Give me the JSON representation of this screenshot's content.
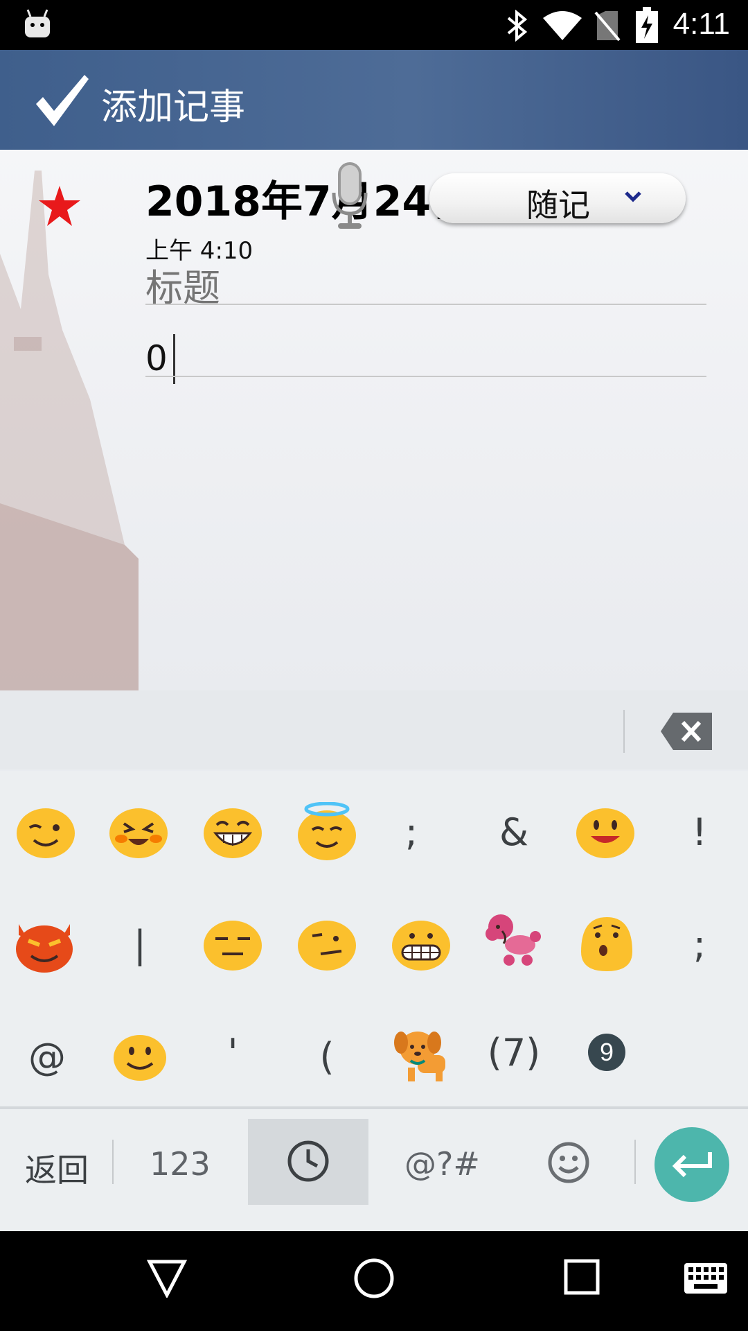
{
  "status_bar": {
    "time": "4:11",
    "icons": [
      "android-icon",
      "bluetooth-icon",
      "wifi-icon",
      "no-sim-icon",
      "battery-charging-icon"
    ]
  },
  "action_bar": {
    "confirm_icon": "checkmark-icon",
    "title": "添加记事"
  },
  "note": {
    "date": "2018年7月24日",
    "time": "上午 4:10",
    "title_placeholder": "标题",
    "body_value": "0",
    "category": "随记",
    "icons": [
      "star-icon",
      "microphone-icon",
      "chevron-down-icon"
    ]
  },
  "keyboard": {
    "delete_icon": "backspace-icon",
    "emoji_rows": [
      [
        "wink",
        "laughing",
        "grin",
        "halo",
        ";",
        "&",
        "smile-tongue",
        "!"
      ],
      [
        "devil",
        "|",
        "expressionless",
        "smirk",
        "grimace",
        "poodle",
        "hushed",
        ";"
      ],
      [
        "@",
        "smile",
        "'",
        "(",
        "dog",
        "(7)",
        "9-keycap",
        ""
      ]
    ],
    "bottom": {
      "back_label": "返回",
      "numbers_label": "123",
      "symbols_label": "@?#",
      "recent_icon": "clock-icon",
      "emoji_icon": "smiley-icon",
      "enter_icon": "enter-icon"
    }
  },
  "nav_bar": {
    "icons": [
      "back-icon",
      "home-icon",
      "recents-icon",
      "keyboard-icon"
    ]
  }
}
